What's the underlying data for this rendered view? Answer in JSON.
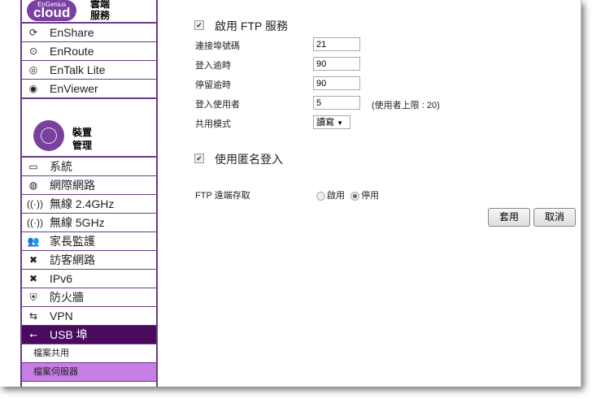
{
  "sidebar": {
    "logo_text": "cloud",
    "logo_brand": "EnGenius",
    "logo_label": "雲端服務",
    "cloud_items": [
      {
        "label": "EnShare",
        "icon": "sync-icon"
      },
      {
        "label": "EnRoute",
        "icon": "location-icon"
      },
      {
        "label": "EnTalk Lite",
        "icon": "talk-icon"
      },
      {
        "label": "EnViewer",
        "icon": "camera-icon"
      }
    ],
    "device_label": "裝置管理",
    "items": [
      {
        "label": "系統",
        "icon": "monitor-icon"
      },
      {
        "label": "網際網路",
        "icon": "globe-icon"
      },
      {
        "label": "無線 2.4GHz",
        "icon": "wireless-icon"
      },
      {
        "label": "無線 5GHz",
        "icon": "wireless-icon"
      },
      {
        "label": "家長監護",
        "icon": "users-icon"
      },
      {
        "label": "訪客網路",
        "icon": "tools-icon"
      },
      {
        "label": "IPv6",
        "icon": "tools-icon"
      },
      {
        "label": "防火牆",
        "icon": "shield-icon"
      },
      {
        "label": "VPN",
        "icon": "arrows-icon"
      },
      {
        "label": "USB 埠",
        "icon": "usb-icon"
      }
    ],
    "sub_items": [
      "檔案共用",
      "檔案伺服器"
    ]
  },
  "form": {
    "enable_ftp": "啟用 FTP 服務",
    "port_label": "連接埠號碼",
    "port_value": "21",
    "login_timeout_label": "登入逾時",
    "login_timeout_value": "90",
    "idle_timeout_label": "停留逾時",
    "idle_timeout_value": "90",
    "users_label": "登入使用者",
    "users_value": "5",
    "users_limit": "(使用者上限 : 20)",
    "share_mode_label": "共用模式",
    "share_mode_value": "讀寫",
    "anonymous": "使用匿名登入",
    "remote_label": "FTP 遠端存取",
    "remote_enable": "啟用",
    "remote_disable": "停用",
    "apply": "套用",
    "cancel": "取消"
  },
  "colors": {
    "accent": "#7a3fa0",
    "active": "#4a0a5e",
    "sub_selected": "#c77fe6"
  }
}
